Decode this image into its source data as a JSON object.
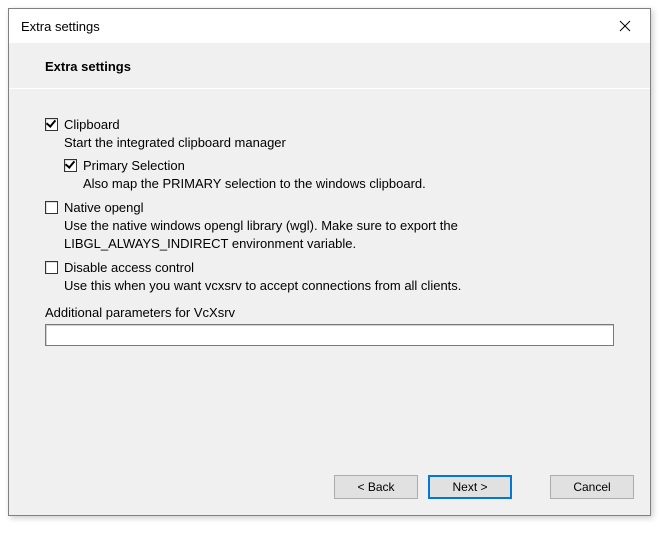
{
  "window": {
    "title": "Extra settings"
  },
  "heading": "Extra settings",
  "options": {
    "clipboard": {
      "label": "Clipboard",
      "desc": "Start the integrated clipboard manager",
      "checked": true,
      "primary": {
        "label": "Primary Selection",
        "desc": "Also map the PRIMARY selection to the windows clipboard.",
        "checked": true
      }
    },
    "native_opengl": {
      "label": "Native opengl",
      "desc": "Use the native windows opengl library (wgl). Make sure to export the LIBGL_ALWAYS_INDIRECT environment variable.",
      "checked": false
    },
    "disable_access": {
      "label": "Disable access control",
      "desc": "Use this when you want vcxsrv to accept connections from all clients.",
      "checked": false
    }
  },
  "params": {
    "label": "Additional parameters for VcXsrv",
    "value": ""
  },
  "buttons": {
    "back": "< Back",
    "next": "Next >",
    "cancel": "Cancel"
  }
}
